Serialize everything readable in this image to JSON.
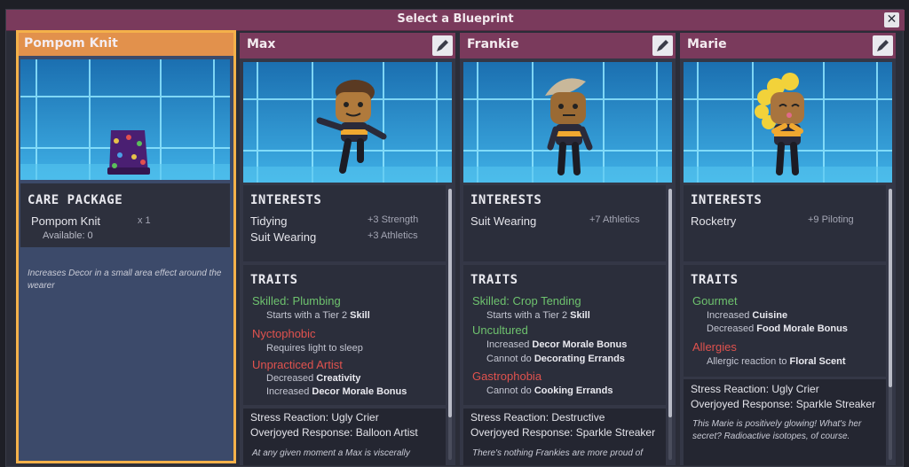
{
  "window": {
    "title": "Select a Blueprint",
    "close_icon": "close-icon"
  },
  "care_package": {
    "name": "Pompom Knit",
    "section_title": "CARE PACKAGE",
    "item_name": "Pompom Knit",
    "quantity": "x 1",
    "available": "Available: 0",
    "description": "Increases Decor in a small area effect around the wearer"
  },
  "dupes": [
    {
      "name": "Max",
      "interests_title": "INTERESTS",
      "interests": [
        {
          "name": "Tidying",
          "bonus": "+3 Strength"
        },
        {
          "name": "Suit Wearing",
          "bonus": "+3 Athletics"
        }
      ],
      "traits_title": "TRAITS",
      "trait1_name": "Skilled: Plumbing",
      "trait1_d1a": "Starts with a Tier 2 ",
      "trait1_d1b": "Skill",
      "trait2_name": "Nyctophobic",
      "trait2_d1": "Requires light to sleep",
      "trait3_name": "Unpracticed Artist",
      "trait3_d1a": "Decreased ",
      "trait3_d1b": "Creativity",
      "trait3_d2a": "Increased ",
      "trait3_d2b": "Decor Morale Bonus",
      "stress_reaction": "Stress Reaction: Ugly Crier",
      "overjoyed_response": "Overjoyed Response: Balloon Artist",
      "flavor": "At any given moment a Max is viscerally"
    },
    {
      "name": "Frankie",
      "interests_title": "INTERESTS",
      "interests": [
        {
          "name": "Suit Wearing",
          "bonus": "+7 Athletics"
        }
      ],
      "traits_title": "TRAITS",
      "trait1_name": "Skilled: Crop Tending",
      "trait1_d1a": "Starts with a Tier 2 ",
      "trait1_d1b": "Skill",
      "trait2_name": "Uncultured",
      "trait2_d1a": "Increased ",
      "trait2_d1b": "Decor Morale Bonus",
      "trait2_d2a": "Cannot do ",
      "trait2_d2b": "Decorating Errands",
      "trait3_name": "Gastrophobia",
      "trait3_d1a": "Cannot do ",
      "trait3_d1b": "Cooking Errands",
      "stress_reaction": "Stress Reaction: Destructive",
      "overjoyed_response": "Overjoyed Response: Sparkle Streaker",
      "flavor": "There's nothing Frankies are more proud of"
    },
    {
      "name": "Marie",
      "interests_title": "INTERESTS",
      "interests": [
        {
          "name": "Rocketry",
          "bonus": "+9 Piloting"
        }
      ],
      "traits_title": "TRAITS",
      "trait1_name": "Gourmet",
      "trait1_d1a": "Increased ",
      "trait1_d1b": "Cuisine",
      "trait1_d2a": "Decreased ",
      "trait1_d2b": "Food Morale Bonus",
      "trait2_name": "Allergies",
      "trait2_d1a": "Allergic reaction to ",
      "trait2_d1b": "Floral Scent",
      "stress_reaction": "Stress Reaction: Ugly Crier",
      "overjoyed_response": "Overjoyed Response: Sparkle Streaker",
      "flavor": "This Marie is positively glowing! What's her secret? Radioactive isotopes, of course."
    }
  ],
  "colors": {
    "header": "#7a3a5c",
    "care_package_header": "#e2914c",
    "care_package_border": "#f4b14a",
    "positive_trait": "#6ec26e",
    "negative_trait": "#e0524e"
  }
}
